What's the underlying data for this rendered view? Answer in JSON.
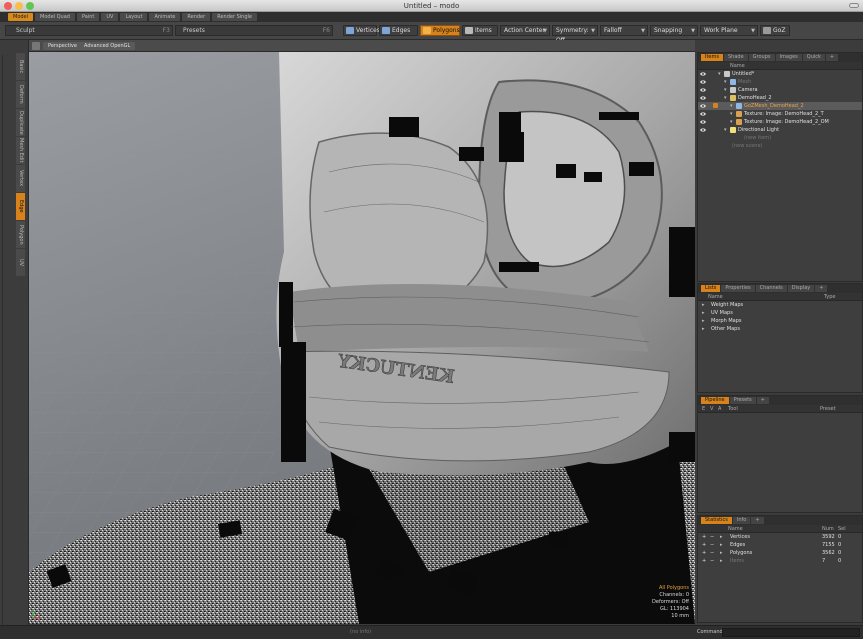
{
  "window": {
    "title": "Untitled – modo"
  },
  "layout_tabs": [
    {
      "label": "Model",
      "active": true
    },
    {
      "label": "Model Quad",
      "active": false
    },
    {
      "label": "Paint",
      "active": false
    },
    {
      "label": "UV",
      "active": false
    },
    {
      "label": "Layout",
      "active": false
    },
    {
      "label": "Animate",
      "active": false
    },
    {
      "label": "Render",
      "active": false
    },
    {
      "label": "Render Single",
      "active": false
    }
  ],
  "toolbar": {
    "sculpt_label": "Sculpt",
    "sculpt_key": "F3",
    "presets_label": "Presets",
    "presets_key": "F6",
    "vertices": "Vertices",
    "edges": "Edges",
    "polygons": "Polygons",
    "items": "Items",
    "action_center": "Action Center",
    "symmetry": "Symmetry: Off",
    "falloff": "Falloff",
    "snapping": "Snapping",
    "work_plane": "Work Plane",
    "goz": "GoZ"
  },
  "left_tabs": [
    "Basic",
    "Deform",
    "Duplicate",
    "Mesh Edit",
    "Vertex",
    "Edge",
    "Polygon",
    "UV"
  ],
  "left_tab_active": "Edge",
  "viewport": {
    "view_label": "Perspective",
    "render_label": "Advanced OpenGL",
    "hud": {
      "mode": "All Polygons",
      "channels": "Channels: 0",
      "deformers": "Deformers: Off",
      "gl": "GL: 113904",
      "scale": "10 mm"
    },
    "decal_text": "KENTUCKY"
  },
  "items_panel": {
    "tabs": [
      "Items",
      "Shade",
      "Groups",
      "Images",
      "Quick"
    ],
    "active_tab": "Items",
    "column": "Name",
    "rows": [
      {
        "label": "Untitled*",
        "indent": 0,
        "icon": "scene-icon",
        "selected": false,
        "dim": false
      },
      {
        "label": "Mesh",
        "indent": 1,
        "icon": "mesh-icon",
        "selected": false,
        "dim": true
      },
      {
        "label": "Camera",
        "indent": 1,
        "icon": "camera-icon",
        "selected": false,
        "dim": false
      },
      {
        "label": "DemoHead_2",
        "indent": 1,
        "icon": "group-icon",
        "selected": false,
        "dim": false
      },
      {
        "label": "GoZMesh_DemoHead_2",
        "indent": 2,
        "icon": "mesh-icon",
        "selected": true,
        "dim": false
      },
      {
        "label": "Texture: Image: DemoHead_2_T",
        "indent": 2,
        "icon": "texture-icon",
        "selected": false,
        "dim": false
      },
      {
        "label": "Texture: Image: DemoHead_2_OM",
        "indent": 2,
        "icon": "texture-icon",
        "selected": false,
        "dim": false
      },
      {
        "label": "Directional Light",
        "indent": 1,
        "icon": "light-icon",
        "selected": false,
        "dim": false
      },
      {
        "label": "(new item)",
        "indent": 2,
        "icon": "",
        "selected": false,
        "dim": true
      },
      {
        "label": "(new scene)",
        "indent": 0,
        "icon": "",
        "selected": false,
        "dim": true
      }
    ]
  },
  "lists_panel": {
    "tabs": [
      "Lists",
      "Properties",
      "Channels",
      "Display"
    ],
    "active_tab": "Lists",
    "columns": [
      "Name",
      "Type"
    ],
    "rows": [
      "Weight Maps",
      "UV Maps",
      "Morph Maps",
      "Other Maps"
    ]
  },
  "pipeline_panel": {
    "tabs": [
      "Pipeline",
      "Presets"
    ],
    "active_tab": "Pipeline",
    "columns": [
      "E",
      "V",
      "A",
      "Tool",
      "Preset"
    ]
  },
  "stats_panel": {
    "tabs": [
      "Statistics",
      "Info"
    ],
    "active_tab": "Statistics",
    "columns": [
      "Name",
      "Num",
      "Sel"
    ],
    "rows": [
      {
        "name": "Vertices",
        "num": "3592",
        "sel": "0"
      },
      {
        "name": "Edges",
        "num": "7155",
        "sel": "0"
      },
      {
        "name": "Polygons",
        "num": "3562",
        "sel": "0"
      },
      {
        "name": "Items",
        "num": "7",
        "sel": "0"
      }
    ]
  },
  "statusbar": {
    "center_text": "(no info)",
    "command_label": "Command"
  },
  "colors": {
    "accent": "#d7821a",
    "panel_bg": "#3e3e3e",
    "toolbar_bg": "#464646"
  }
}
